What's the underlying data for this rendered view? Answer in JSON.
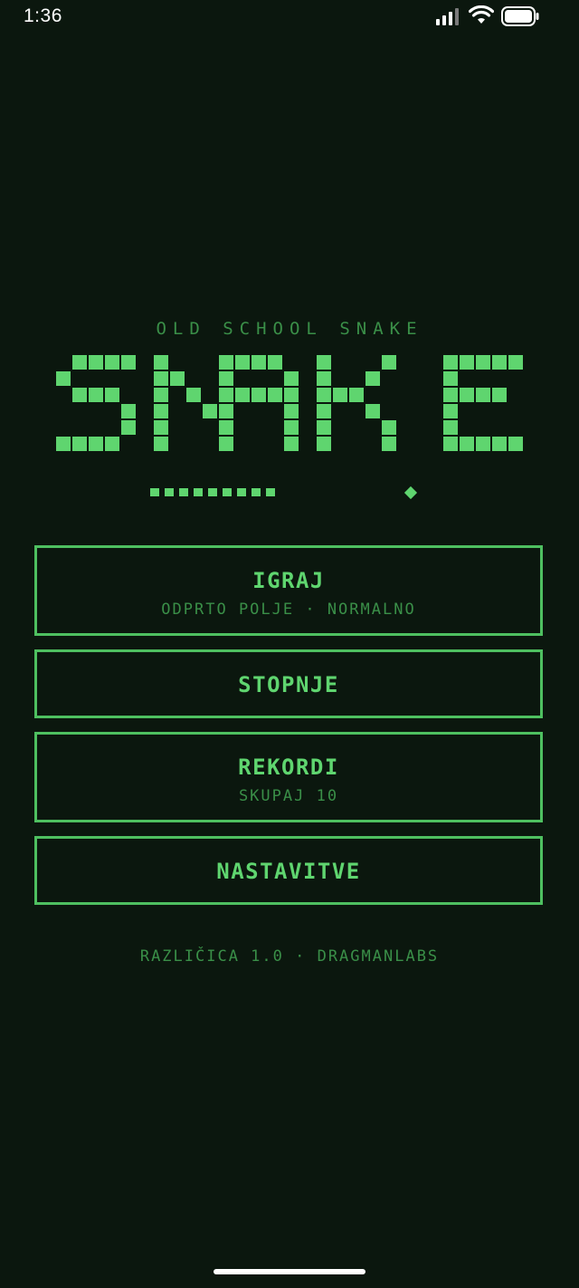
{
  "status_bar": {
    "time": "1:36",
    "icons": [
      "signal-icon",
      "wifi-icon",
      "battery-icon"
    ]
  },
  "header": {
    "subtitle": "OLD SCHOOL SNAKE",
    "logo_text": "SNAKE"
  },
  "menu": {
    "play": {
      "label": "IGRAJ",
      "sub": "ODPRTO POLJE · NORMALNO"
    },
    "levels": {
      "label": "STOPNJE"
    },
    "records": {
      "label": "REKORDI",
      "sub": "SKUPAJ 10"
    },
    "settings": {
      "label": "NASTAVITVE"
    }
  },
  "footer": {
    "text": "RAZLIČICA 1.0 · DRAGMANLABS"
  },
  "colors": {
    "background": "#0b170e",
    "accent": "#5fd56f",
    "muted": "#3a8f48"
  }
}
